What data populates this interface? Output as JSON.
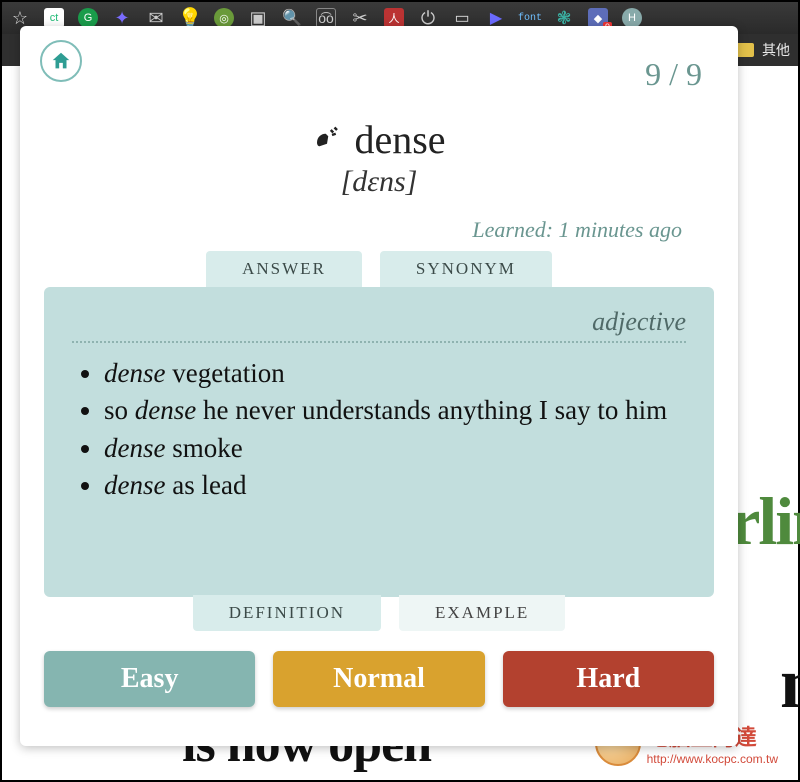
{
  "browser": {
    "bookmark_label": "其他"
  },
  "background": {
    "line1": "rlin",
    "line2": "n",
    "line3": "is now open"
  },
  "watermark": {
    "title": "電腦王阿達",
    "url": "http://www.kocpc.com.tw"
  },
  "card": {
    "counter": "9 / 9",
    "word": "dense",
    "pronunciation": "[dɛns]",
    "learned": "Learned: 1 minutes ago",
    "tabs": {
      "answer": "ANSWER",
      "synonym": "SYNONYM",
      "definition": "DEFINITION",
      "example": "EXAMPLE"
    },
    "part_of_speech": "adjective",
    "examples": [
      {
        "kw": "dense",
        "rest": " vegetation"
      },
      {
        "kw_prefix": "so ",
        "kw": "dense",
        "rest": " he never understands anything I say to him"
      },
      {
        "kw": "dense",
        "rest": " smoke"
      },
      {
        "kw": "dense",
        "rest": " as lead"
      }
    ],
    "buttons": {
      "easy": "Easy",
      "normal": "Normal",
      "hard": "Hard"
    }
  }
}
